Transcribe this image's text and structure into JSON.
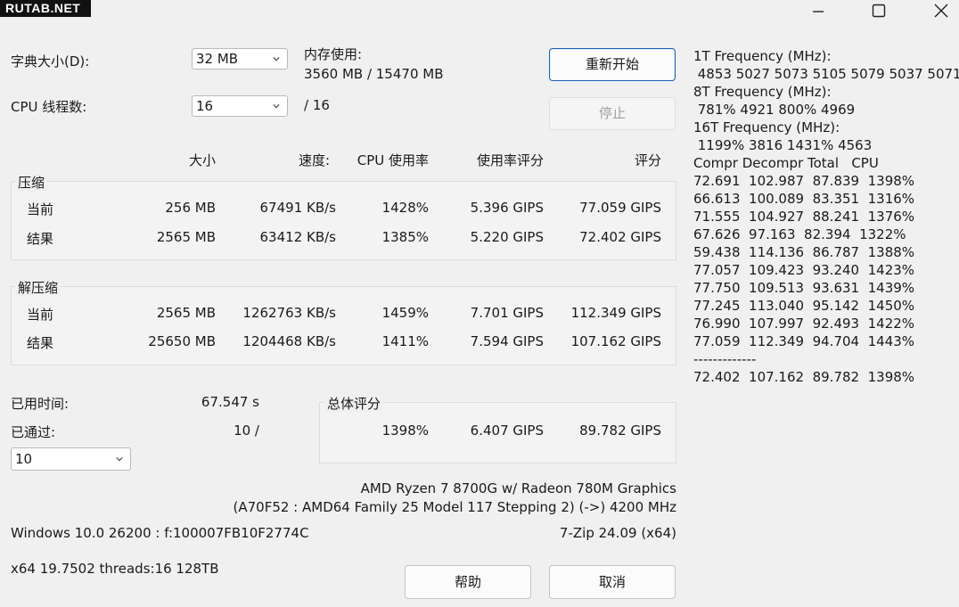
{
  "watermark": "RUTAB.NET",
  "window": {
    "minimize": "—",
    "maximize": "☐",
    "close": "✕"
  },
  "dict_label": "字典大小(D):",
  "dict_value": "32 MB",
  "threads_label": "CPU 线程数:",
  "threads_value": "16",
  "threads_total": "/ 16",
  "memory_label": "内存使用:",
  "memory_value": "3560 MB / 15470 MB",
  "restart_label": "重新开始",
  "stop_label": "停止",
  "headers": {
    "size": "大小",
    "speed": "速度:",
    "cpu": "CPU 使用率",
    "rating": "使用率评分",
    "score": "评分"
  },
  "compress": {
    "title": "压缩",
    "rows": [
      {
        "label": "当前",
        "size": "256 MB",
        "speed": "67491 KB/s",
        "cpu": "1428%",
        "rating": "5.396 GIPS",
        "score": "77.059 GIPS"
      },
      {
        "label": "结果",
        "size": "2565 MB",
        "speed": "63412 KB/s",
        "cpu": "1385%",
        "rating": "5.220 GIPS",
        "score": "72.402 GIPS"
      }
    ]
  },
  "decompress": {
    "title": "解压缩",
    "rows": [
      {
        "label": "当前",
        "size": "2565 MB",
        "speed": "1262763 KB/s",
        "cpu": "1459%",
        "rating": "7.701 GIPS",
        "score": "112.349 GIPS"
      },
      {
        "label": "结果",
        "size": "25650 MB",
        "speed": "1204468 KB/s",
        "cpu": "1411%",
        "rating": "7.594 GIPS",
        "score": "107.162 GIPS"
      }
    ]
  },
  "elapsed_label": "已用时间:",
  "elapsed_value": "67.547 s",
  "passes_label": "已通过:",
  "passes_value": "10 /",
  "passes_select": "10",
  "total": {
    "title": "总体评分",
    "cpu": "1398%",
    "rating": "6.407 GIPS",
    "score": "89.782 GIPS"
  },
  "cpu_name": "AMD Ryzen 7 8700G w/ Radeon 780M Graphics",
  "cpu_detail": "(A70F52 : AMD64 Family 25 Model 117 Stepping 2) (->) 4200 MHz",
  "os_info": "Windows 10.0 26200 :  f:100007FB10F2774C",
  "version": "7-Zip 24.09 (x64)",
  "arch_info": "x64 19.7502 threads:16 128TB",
  "help_label": "帮助",
  "cancel_label": "取消",
  "log": [
    "1T Frequency (MHz):",
    " 4853 5027 5073 5105 5079 5037 5071",
    "8T Frequency (MHz):",
    " 781% 4921 800% 4969",
    "16T Frequency (MHz):",
    " 1199% 3816 1431% 4563",
    "Compr Decompr Total   CPU",
    "72.691  102.987  87.839  1398%",
    "66.613  100.089  83.351  1316%",
    "71.555  104.927  88.241  1376%",
    "67.626  97.163  82.394  1322%",
    "59.438  114.136  86.787  1388%",
    "77.057  109.423  93.240  1423%",
    "77.750  109.513  93.631  1439%",
    "77.245  113.040  95.142  1450%",
    "76.990  107.997  92.493  1422%",
    "77.059  112.349  94.704  1443%",
    "-------------",
    "72.402  107.162  89.782  1398%"
  ]
}
